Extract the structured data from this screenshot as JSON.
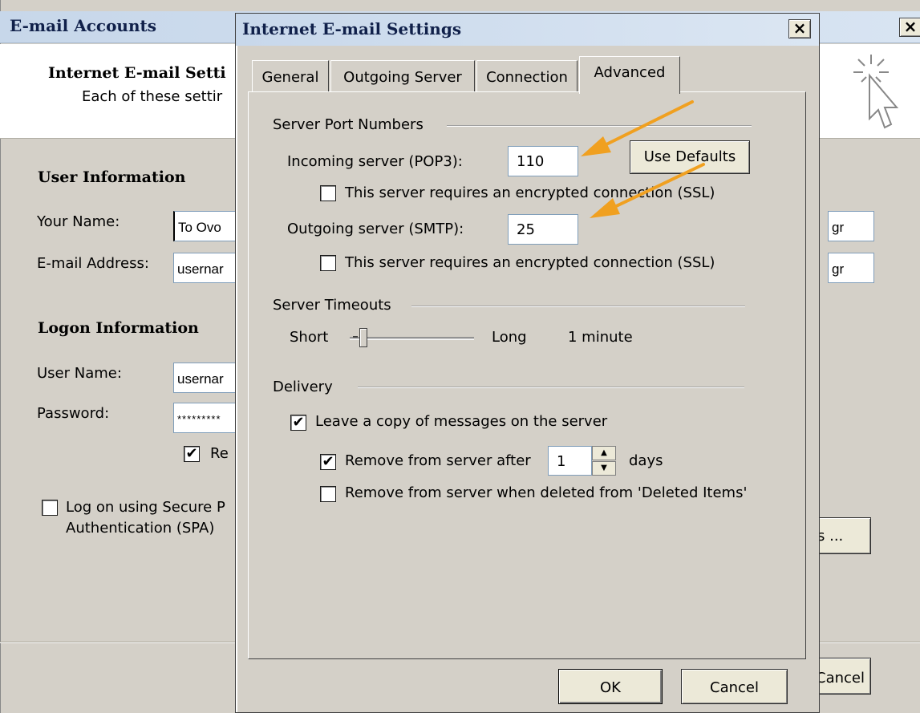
{
  "background_window": {
    "title": "E-mail Accounts",
    "close_glyph": "×",
    "header_title": "Internet E-mail Setti",
    "header_description": "Each of these settir",
    "user_info_title": "User Information",
    "your_name_label": "Your Name:",
    "your_name_value": "To Ovo",
    "your_name_right_value": "gr",
    "email_label": "E-mail Address:",
    "email_value": "usernar",
    "email_right_value": "gr",
    "logon_info_title": "Logon Information",
    "username_label": "User Name:",
    "username_value": "usernar",
    "password_label": "Password:",
    "password_value": "*********",
    "remember_label": "Re",
    "remember_checked": true,
    "spa_label_line1": "Log on using Secure P",
    "spa_label_line2": "Authentication (SPA)",
    "spa_checked": false,
    "more_settings_label": "s ...",
    "cancel_label": "Cancel",
    "cursor_icon": "pointer-click-icon"
  },
  "dialog": {
    "title": "Internet E-mail Settings",
    "close_glyph": "×",
    "tabs": [
      {
        "label": "General"
      },
      {
        "label": "Outgoing Server"
      },
      {
        "label": "Connection"
      },
      {
        "label": "Advanced",
        "active": true
      }
    ],
    "ports": {
      "group_label": "Server Port Numbers",
      "incoming_label": "Incoming server (POP3):",
      "incoming_value": "110",
      "use_defaults_label": "Use Defaults",
      "ssl_incoming_label": "This server requires an encrypted connection (SSL)",
      "ssl_incoming_checked": false,
      "outgoing_label": "Outgoing server (SMTP):",
      "outgoing_value": "25",
      "ssl_outgoing_label": "This server requires an encrypted connection (SSL)",
      "ssl_outgoing_checked": false
    },
    "timeouts": {
      "group_label": "Server Timeouts",
      "short_label": "Short",
      "long_label": "Long",
      "value_label": "1 minute",
      "slider_level": 0.1
    },
    "delivery": {
      "group_label": "Delivery",
      "leave_copy_label": "Leave a copy of messages on the server",
      "leave_copy_checked": true,
      "remove_after_label": "Remove from server after",
      "remove_after_checked": true,
      "days_value": "1",
      "days_label": "days",
      "remove_deleted_label": "Remove from server when deleted from 'Deleted Items'",
      "remove_deleted_checked": false
    },
    "ok_label": "OK",
    "cancel_label": "Cancel"
  },
  "colors": {
    "dialog_face": "#d4d0c8",
    "titlebar": "#c8d8eb",
    "annotation_arrow": "#f0a020"
  }
}
